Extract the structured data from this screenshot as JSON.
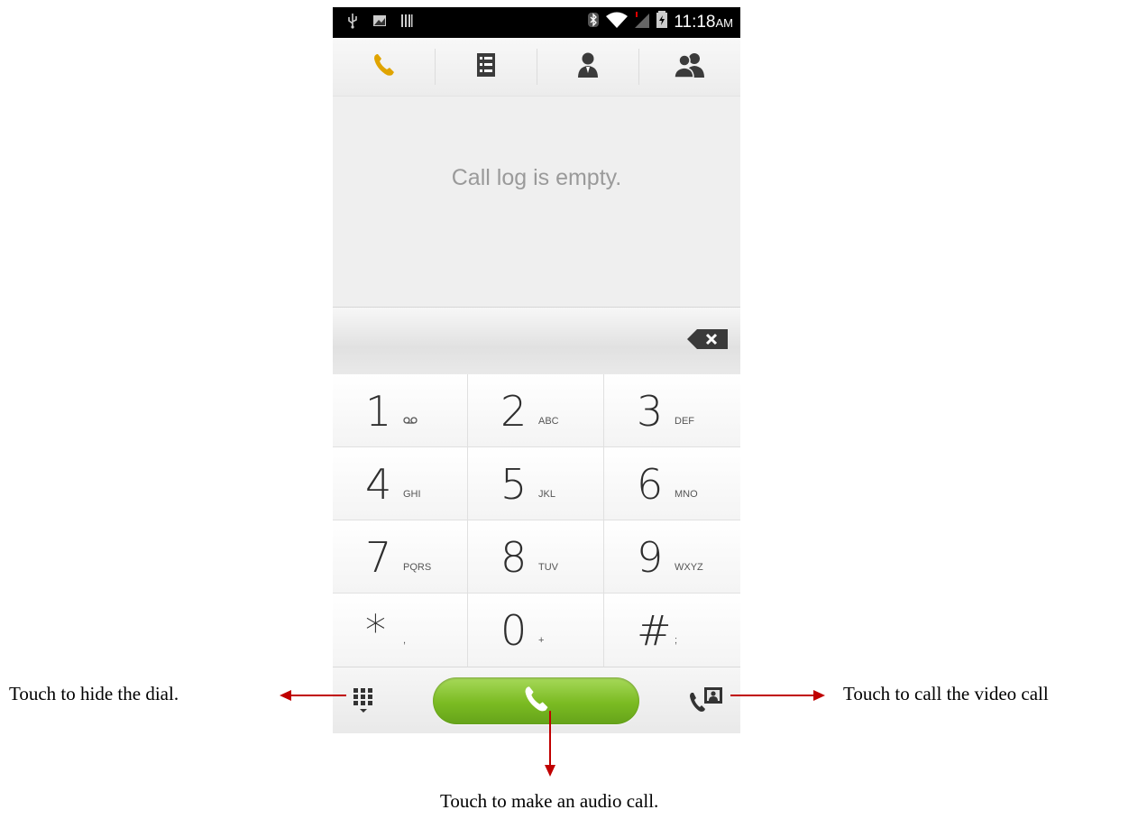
{
  "status_bar": {
    "time": "11:18",
    "ampm": "AM",
    "left_icons": [
      "usb-icon",
      "image-icon",
      "barcode-icon"
    ],
    "right_icons": [
      "bluetooth-icon",
      "wifi-icon",
      "signal-icon",
      "battery-icon"
    ]
  },
  "tabs": [
    {
      "icon": "phone-icon",
      "active": true
    },
    {
      "icon": "call-log-list-icon",
      "active": false
    },
    {
      "icon": "contact-icon",
      "active": false
    },
    {
      "icon": "groups-icon",
      "active": false
    }
  ],
  "call_log": {
    "empty_message": "Call log is empty."
  },
  "keypad": {
    "keys": [
      {
        "digit": "1",
        "letters": "oo"
      },
      {
        "digit": "2",
        "letters": "ABC"
      },
      {
        "digit": "3",
        "letters": "DEF"
      },
      {
        "digit": "4",
        "letters": "GHI"
      },
      {
        "digit": "5",
        "letters": "JKL"
      },
      {
        "digit": "6",
        "letters": "MNO"
      },
      {
        "digit": "7",
        "letters": "PQRS"
      },
      {
        "digit": "8",
        "letters": "TUV"
      },
      {
        "digit": "9",
        "letters": "WXYZ"
      },
      {
        "digit": "*",
        "letters": ","
      },
      {
        "digit": "0",
        "letters": "+"
      },
      {
        "digit": "#",
        "letters": ";"
      }
    ]
  },
  "colors": {
    "accent_tab": "#e0a400",
    "call_green": "#7bbb22",
    "annotation_arrow": "#c00000"
  },
  "annotations": {
    "hide_dial": "Touch to hide the dial.",
    "video_call": "Touch to call the video call",
    "audio_call": "Touch to make an audio call."
  }
}
